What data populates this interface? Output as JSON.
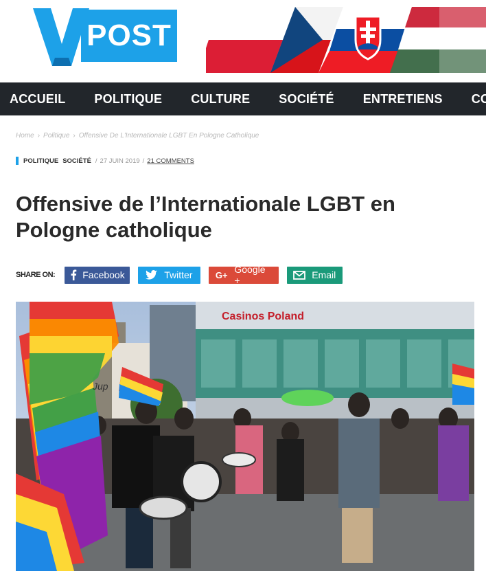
{
  "site": {
    "logo_text": "POST",
    "logo_letter": "V"
  },
  "nav": {
    "items": [
      "ACCUEIL",
      "POLITIQUE",
      "CULTURE",
      "SOCIÉTÉ",
      "ENTRETIENS",
      "CO"
    ]
  },
  "breadcrumb": {
    "home": "Home",
    "section": "Politique",
    "current": "Offensive De L'Internationale LGBT En Pologne Catholique"
  },
  "meta": {
    "category1": "POLITIQUE",
    "category2": "SOCIÉTÉ",
    "date": "27 JUIN 2019",
    "comments": "21 COMMENTS"
  },
  "article": {
    "title": "Offensive de l’Internationale LGBT en Pologne catholique"
  },
  "share": {
    "label": "SHARE ON:",
    "facebook": "Facebook",
    "twitter": "Twitter",
    "google": "Google +",
    "email": "Email"
  },
  "photo": {
    "sign_text": "Casinos Poland",
    "shop_text": "Jup"
  },
  "colors": {
    "brand_blue": "#1da1e8",
    "nav_bg": "#22262b",
    "facebook": "#3b5998",
    "twitter": "#1da1e8",
    "google": "#db4a39",
    "email": "#1a9a7a"
  }
}
